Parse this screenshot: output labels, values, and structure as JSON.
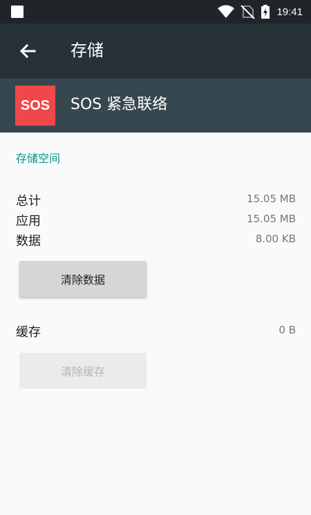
{
  "status_bar": {
    "time": "19:41",
    "icons": [
      "notification-square-icon",
      "wifi-icon",
      "no-sim-icon",
      "battery-charging-icon"
    ]
  },
  "toolbar": {
    "back_icon": "arrow-back-icon",
    "title": "存储"
  },
  "app": {
    "icon_text": "SOS",
    "name": "SOS 紧急联络"
  },
  "storage": {
    "section_title": "存储空间",
    "rows": [
      {
        "label": "总计",
        "value": "15.05 MB"
      },
      {
        "label": "应用",
        "value": "15.05 MB"
      },
      {
        "label": "数据",
        "value": "8.00 KB"
      }
    ],
    "clear_data_label": "清除数据"
  },
  "cache": {
    "label": "缓存",
    "value": "0 B",
    "clear_cache_label": "清除缓存"
  },
  "colors": {
    "status_bar": "#1f2529",
    "toolbar": "#263238",
    "app_header": "#37474f",
    "accent": "#009688",
    "app_icon": "#f0474b"
  }
}
